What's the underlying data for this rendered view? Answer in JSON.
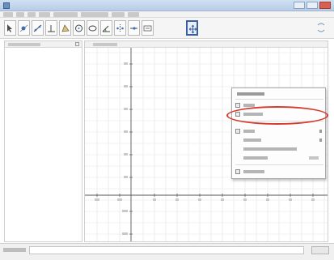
{
  "window": {
    "title": ""
  },
  "menu": {
    "items": [
      "",
      "",
      "",
      "",
      "",
      "",
      "",
      ""
    ]
  },
  "toolbar": {
    "tools": [
      {
        "icon": "pointer-icon",
        "active": false
      },
      {
        "icon": "point-icon",
        "active": false
      },
      {
        "icon": "line-icon",
        "active": false
      },
      {
        "icon": "perpendicular-icon",
        "active": false
      },
      {
        "icon": "polygon-icon",
        "active": false
      },
      {
        "icon": "circle-icon",
        "active": false
      },
      {
        "icon": "ellipse-icon",
        "active": false
      },
      {
        "icon": "angle-icon",
        "active": false
      },
      {
        "icon": "reflect-icon",
        "active": false
      },
      {
        "icon": "slider-icon",
        "active": false
      },
      {
        "icon": "text-icon",
        "active": false
      },
      {
        "icon": "move-view-icon",
        "active": true
      }
    ]
  },
  "algebra_panel": {
    "title": ""
  },
  "graphics_panel": {
    "title": "",
    "y_axis_labels": [
      "",
      "",
      "",
      "",
      "",
      "",
      "",
      "",
      "",
      ""
    ],
    "x_axis_labels": [
      "",
      "",
      "",
      "",
      "",
      "",
      "",
      "",
      "",
      "",
      ""
    ]
  },
  "context_menu": {
    "title": "",
    "items": [
      {
        "label": "",
        "icon": "axes-icon"
      },
      {
        "label": "",
        "icon": "grid-icon",
        "highlighted": true
      },
      {
        "label": "",
        "icon": "navigation-icon",
        "has_submenu": true
      },
      {
        "label": "",
        "icon": "",
        "has_submenu": true
      },
      {
        "label": "",
        "icon": ""
      },
      {
        "label": "",
        "icon": "",
        "shortcut": ""
      },
      {
        "label": "",
        "icon": "graphics-settings-icon"
      }
    ]
  },
  "input_bar": {
    "label": "",
    "value": ""
  },
  "colors": {
    "highlight_ellipse": "#d73a2c",
    "active_tool_border": "#3b5fa0"
  }
}
